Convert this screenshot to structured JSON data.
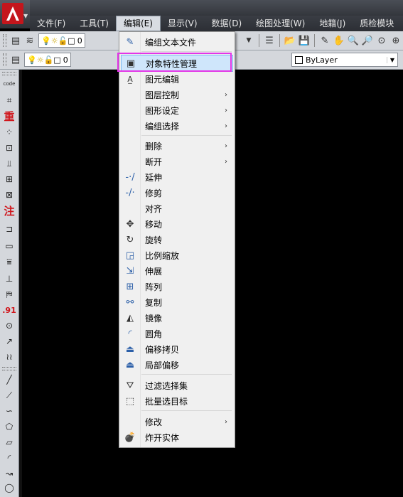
{
  "menubar": {
    "items": [
      "文件(F)",
      "工具(T)",
      "编辑(E)",
      "显示(V)",
      "数据(D)",
      "绘图处理(W)",
      "地籍(J)",
      "质检模块"
    ]
  },
  "toolbar": {
    "layer_name_1": "0",
    "layer_name_2": "0",
    "bylayer_label": "ByLayer"
  },
  "left_toolbar": {
    "code_label": "code",
    "zhong_label": "重",
    "zhu_label": "注",
    "num_label": ".91"
  },
  "edit_menu": {
    "items": [
      {
        "label": "编组文本文件",
        "icon": "edit-text-icon",
        "submenu": false
      },
      {
        "label": "对象特性管理",
        "icon": "properties-icon",
        "submenu": false,
        "highlighted": true
      },
      {
        "label": "图元编辑",
        "icon": "text-edit-icon",
        "submenu": false
      },
      {
        "label": "图层控制",
        "icon": "",
        "submenu": true
      },
      {
        "label": "图形设定",
        "icon": "",
        "submenu": true
      },
      {
        "label": "编组选择",
        "icon": "",
        "submenu": true
      },
      {
        "label": "删除",
        "icon": "",
        "submenu": true
      },
      {
        "label": "断开",
        "icon": "",
        "submenu": true
      },
      {
        "label": "延伸",
        "icon": "extend-icon",
        "submenu": false
      },
      {
        "label": "修剪",
        "icon": "trim-icon",
        "submenu": false
      },
      {
        "label": "对齐",
        "icon": "",
        "submenu": false
      },
      {
        "label": "移动",
        "icon": "move-icon",
        "submenu": false
      },
      {
        "label": "旋转",
        "icon": "rotate-icon",
        "submenu": false
      },
      {
        "label": "比例缩放",
        "icon": "scale-icon",
        "submenu": false
      },
      {
        "label": "伸展",
        "icon": "stretch-icon",
        "submenu": false
      },
      {
        "label": "阵列",
        "icon": "array-icon",
        "submenu": false
      },
      {
        "label": "复制",
        "icon": "copy-icon",
        "submenu": false
      },
      {
        "label": "镜像",
        "icon": "mirror-icon",
        "submenu": false
      },
      {
        "label": "圆角",
        "icon": "fillet-icon",
        "submenu": false
      },
      {
        "label": "偏移拷贝",
        "icon": "offset-icon",
        "submenu": false
      },
      {
        "label": "局部偏移",
        "icon": "partial-offset-icon",
        "submenu": false
      },
      {
        "label": "过滤选择集",
        "icon": "filter-icon",
        "submenu": false
      },
      {
        "label": "批量选目标",
        "icon": "batch-select-icon",
        "submenu": false
      },
      {
        "label": "修改",
        "icon": "",
        "submenu": true
      },
      {
        "label": "炸开实体",
        "icon": "explode-icon",
        "submenu": false
      }
    ]
  },
  "colors": {
    "highlight_frame": "#e336e8",
    "highlight_fill": "#cfe6fb",
    "app_logo": "#c4161c"
  }
}
